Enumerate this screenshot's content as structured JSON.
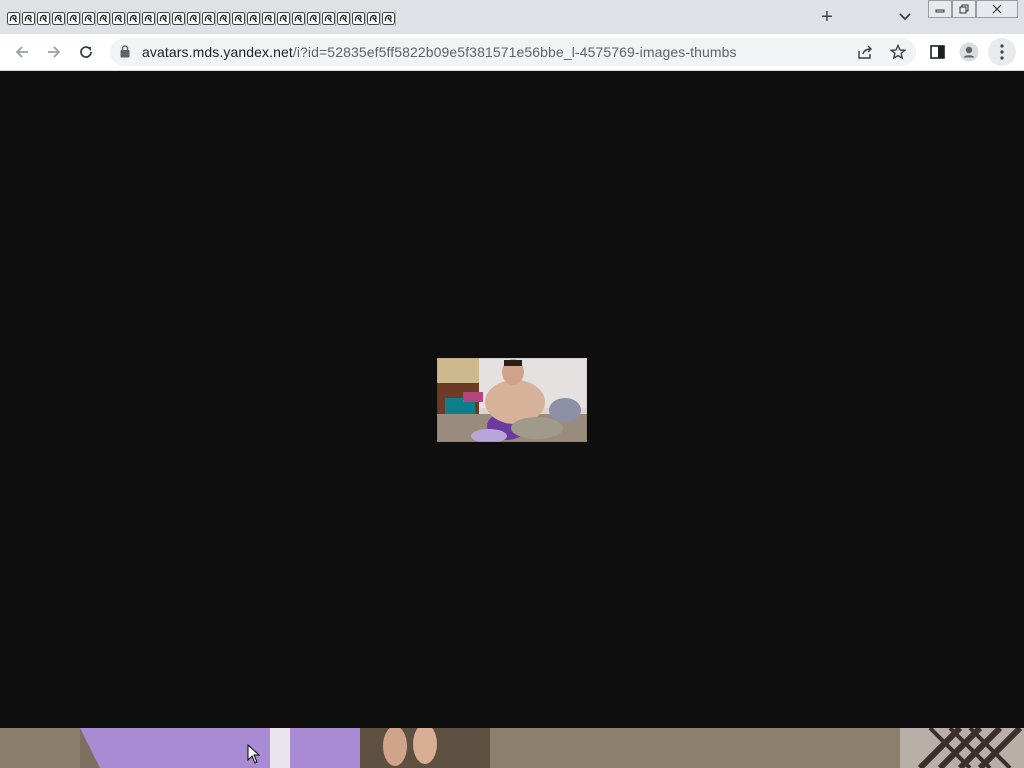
{
  "browser": {
    "tab_count": 26,
    "tab_favicon": "yandex-swirl-icon",
    "new_tab_label": "+",
    "url_host": "avatars.mds.yandex.net",
    "url_path": "/i?id=52835ef5ff5822b09e5f381571e56bbe_l-4575769-images-thumbs"
  },
  "colors": {
    "tabstrip": "#dee1e6",
    "toolbar": "#ffffff",
    "omnibox": "#f1f3f4",
    "page_background": "#0e0e0e"
  },
  "icons": {
    "back": "arrow-left-icon",
    "forward": "arrow-right-icon",
    "reload": "reload-icon",
    "lock": "lock-icon",
    "share": "share-icon",
    "bookmark": "star-icon",
    "side_panel": "side-panel-icon",
    "profile": "profile-icon",
    "menu": "kebab-menu-icon"
  }
}
